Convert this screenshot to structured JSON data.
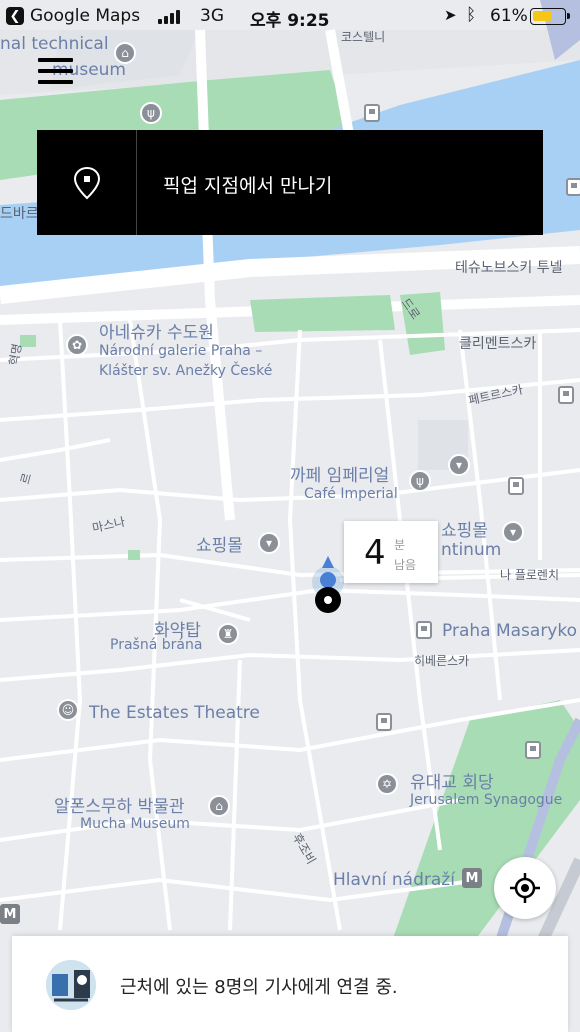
{
  "status_bar": {
    "back_app": "Google Maps",
    "network": "3G",
    "time": "오후 9:25",
    "battery_percent": "61%",
    "battery_level": 0.61
  },
  "pickup_banner": {
    "text": "픽업 지점에서 만나기",
    "icon": "location-pin-icon"
  },
  "eta": {
    "value": "4",
    "unit": "분",
    "remaining": "남음"
  },
  "connecting": {
    "text": "근처에 있는 8명의 기사에게 연결 중."
  },
  "map": {
    "colors": {
      "water": "#a8d0f5",
      "park": "#a8dcb4",
      "road": "#ffffff",
      "land": "#e9ebee",
      "route": "#5b9bd5"
    },
    "labels": {
      "technical": "nal technical",
      "museum_cut": "museum",
      "kostelni": "코스텔니",
      "teshunovska": "테슈노브스키 투넬",
      "agnes_ko": "아네슈카 수도원",
      "agnes_cz1": "Národní galerie Praha –",
      "agnes_cz2": "Klášter sv. Anežky České",
      "klimentska": "클리멘트스카",
      "petrska": "페트르스카",
      "cafe_ko": "까페 임페리얼",
      "cafe_en": "Café Imperial",
      "shopping1": "쇼핑몰",
      "shopping2": "쇼핑몰",
      "palladium": "ntinum",
      "na_florenci": "나 플로렌치",
      "powder_ko": "화약탑",
      "powder_cz": "Prašná brána",
      "masaryk": "Praha Masaryko",
      "hybernska": "히베른스카",
      "estates": "The Estates Theatre",
      "synagogue_ko": "유대교 회당",
      "synagogue_en": "Jerusalem Synagogue",
      "mucha_ko": "알폰스무하 박물관",
      "mucha_en": "Mucha Museum",
      "hlavni": "Hlavní nádraží",
      "masna": "마스나",
      "revolucni": "혁명",
      "dlouha": "드로",
      "vltava_left": "드바르",
      "rybna": "르",
      "hlavni_road": "후조비"
    }
  }
}
